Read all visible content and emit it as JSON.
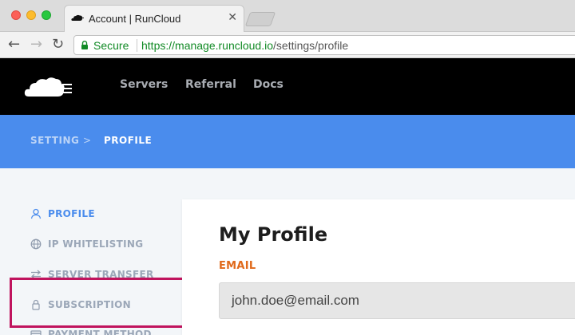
{
  "browser": {
    "tab_title": "Account | RunCloud",
    "secure_label": "Secure",
    "url_scheme": "https://",
    "url_host": "manage.runcloud.io",
    "url_path": "/settings/profile"
  },
  "appbar": {
    "nav": [
      "Servers",
      "Referral",
      "Docs"
    ]
  },
  "breadcrumb": {
    "items": [
      "SETTING",
      "PROFILE"
    ],
    "separator": ">"
  },
  "sidebar": {
    "items": [
      {
        "label": "PROFILE",
        "icon": "user-icon",
        "active": true
      },
      {
        "label": "IP WHITELISTING",
        "icon": "globe-icon",
        "active": false
      },
      {
        "label": "SERVER TRANSFER",
        "icon": "transfer-icon",
        "active": false
      },
      {
        "label": "SUBSCRIPTION",
        "icon": "lock-icon",
        "active": false
      },
      {
        "label": "PAYMENT METHOD",
        "icon": "card-icon",
        "active": false
      }
    ]
  },
  "profile": {
    "title": "My Profile",
    "email_label": "EMAIL",
    "email_value": "john.doe@email.com"
  },
  "colors": {
    "accent": "#4a8ced",
    "highlight": "#c0145e",
    "label": "#e0691a",
    "appbar": "#000000"
  }
}
